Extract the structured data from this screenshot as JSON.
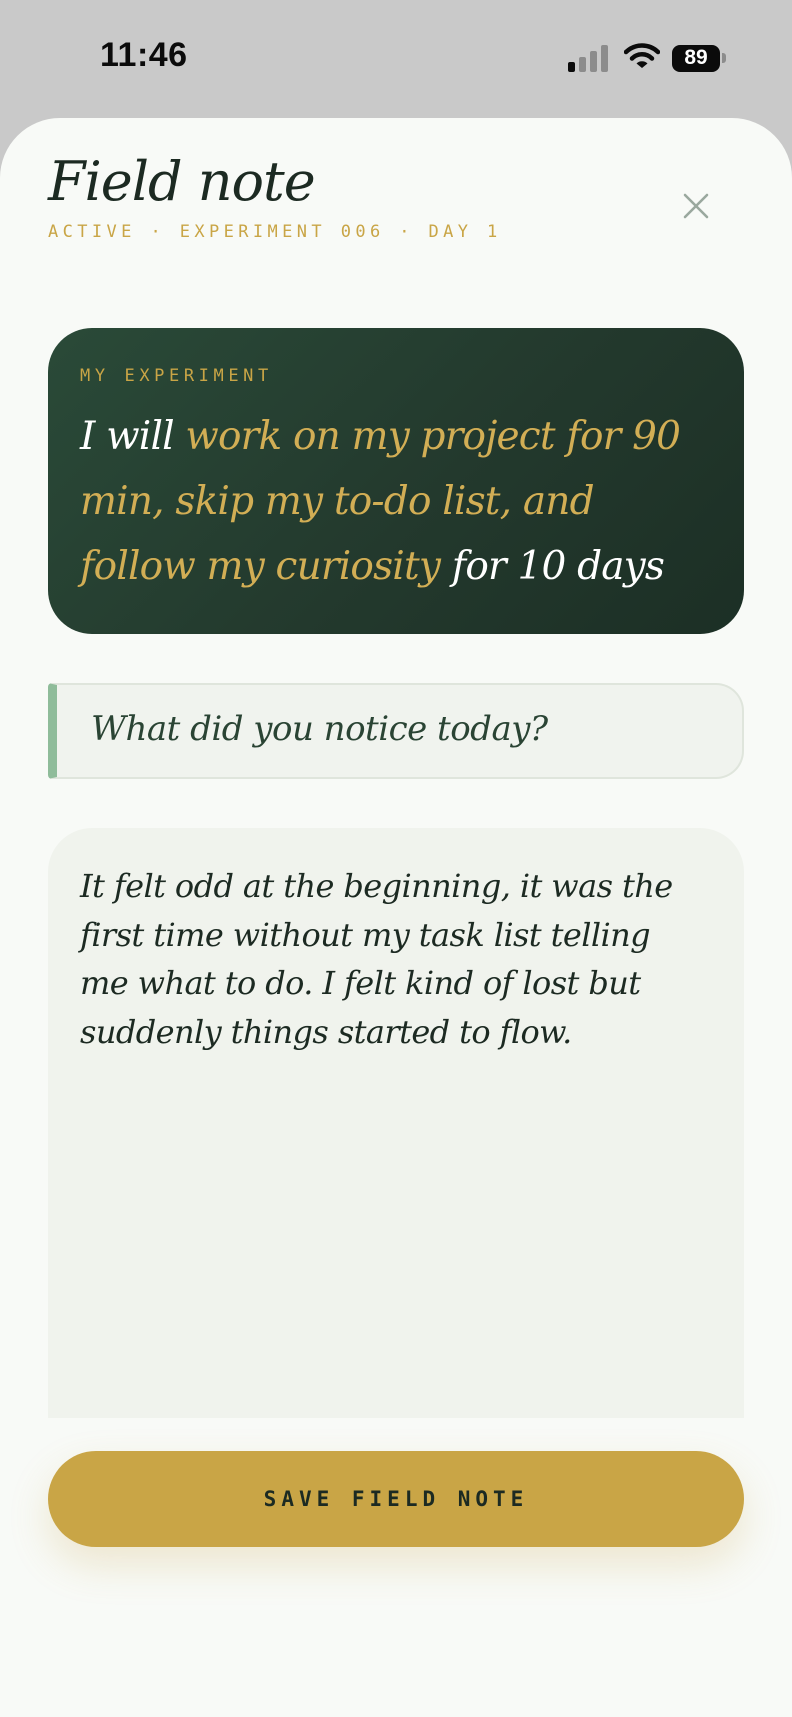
{
  "status_bar": {
    "time": "11:46",
    "battery_level": "89",
    "signal_bars_active": 1,
    "signal_bars_total": 4,
    "icons": [
      "signal-icon",
      "wifi-icon",
      "battery-icon"
    ]
  },
  "header": {
    "title": "Field note",
    "subtitle": "ACTIVE · EXPERIMENT 006 · DAY 1",
    "close_icon": "close-icon"
  },
  "experiment": {
    "label": "MY EXPERIMENT",
    "prefix": "I will ",
    "action": "work on my project for 90 min, skip my to-do list, and follow my curiosity",
    "suffix": " for 10 days"
  },
  "prompt": {
    "question": "What did you notice today?"
  },
  "note": {
    "lines": [
      "It felt odd at the beginning, it was the",
      "first time without my task list telling",
      "me what to do. I felt kind of lost but",
      "suddenly things started to flow."
    ]
  },
  "actions": {
    "save_label": "SAVE FIELD NOTE"
  },
  "colors": {
    "accent_gold": "#c9a546",
    "deep_green": "#23392d",
    "mint_bar": "#8fbc9a",
    "background": "#f8faf7"
  }
}
